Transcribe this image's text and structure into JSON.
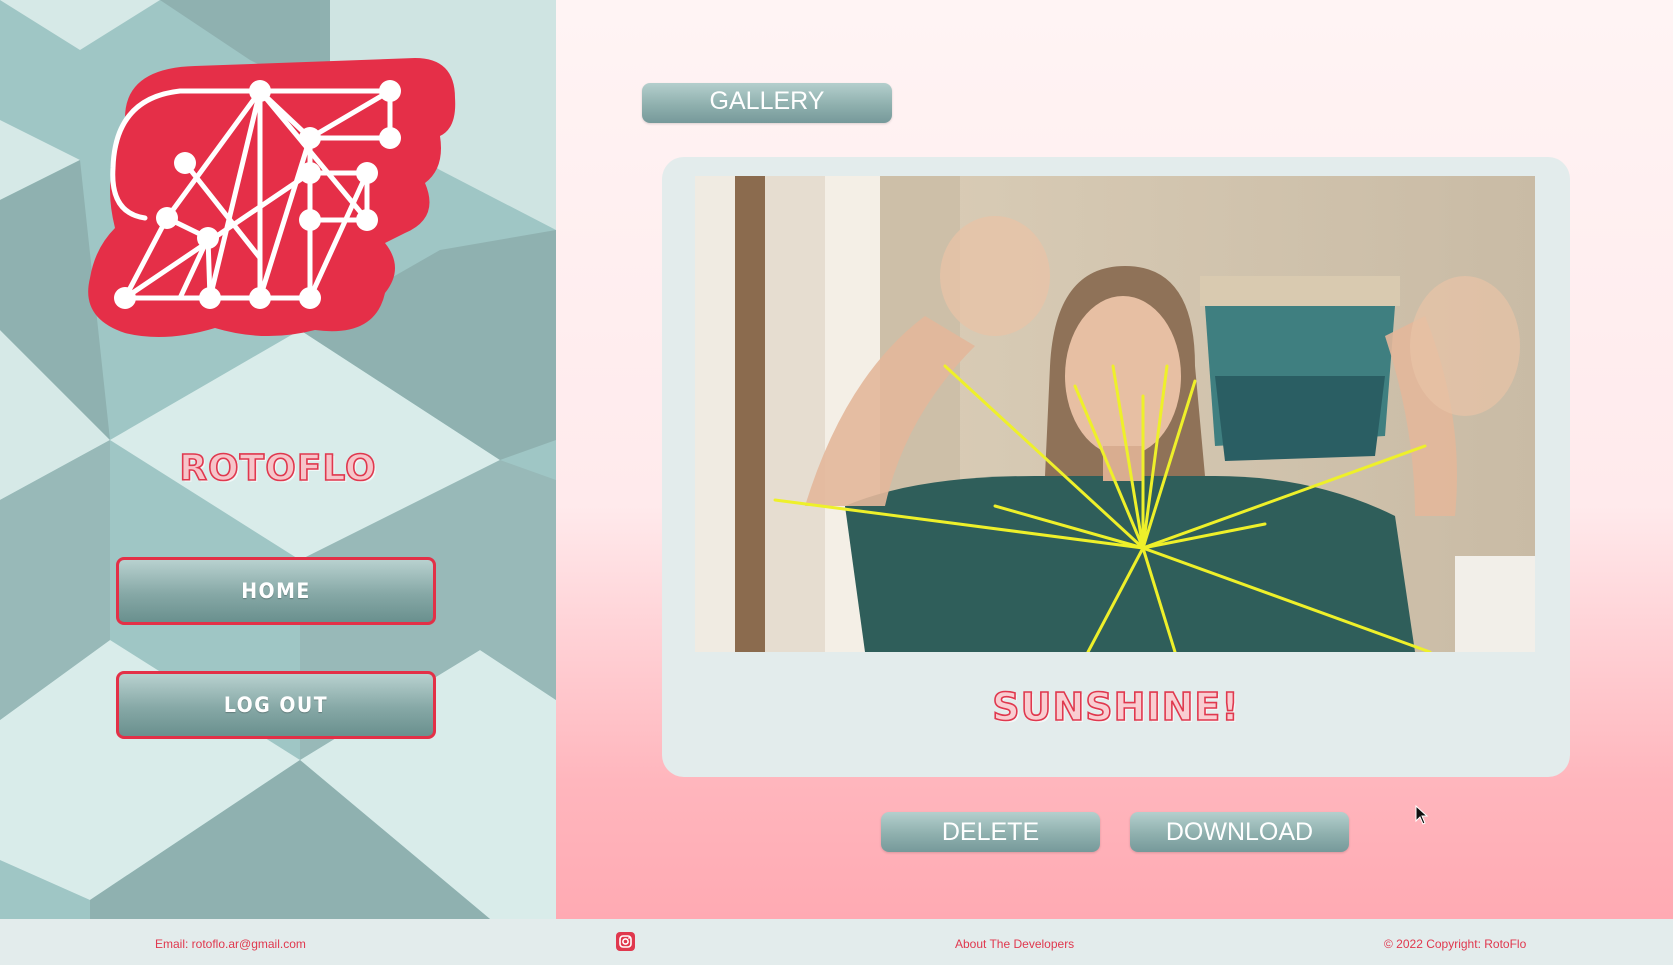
{
  "brand": {
    "name": "ROTOFLO"
  },
  "nav": {
    "home_label": "HOME",
    "logout_label": "LOG OUT"
  },
  "main": {
    "section_label": "GALLERY",
    "entry": {
      "caption": "SUNSHINE!"
    },
    "actions": {
      "delete_label": "DELETE",
      "download_label": "DOWNLOAD"
    }
  },
  "footer": {
    "email": "Email: rotoflo.ar@gmail.com",
    "instagram_icon": "instagram-icon",
    "about_label": "About The Developers",
    "copyright": "© 2022 Copyright: RotoFlo"
  },
  "colors": {
    "accent": "#e0384e",
    "button_teal": "#86a8a6",
    "card_bg": "#e3ecec",
    "overlay_lines": "#eef02a"
  }
}
